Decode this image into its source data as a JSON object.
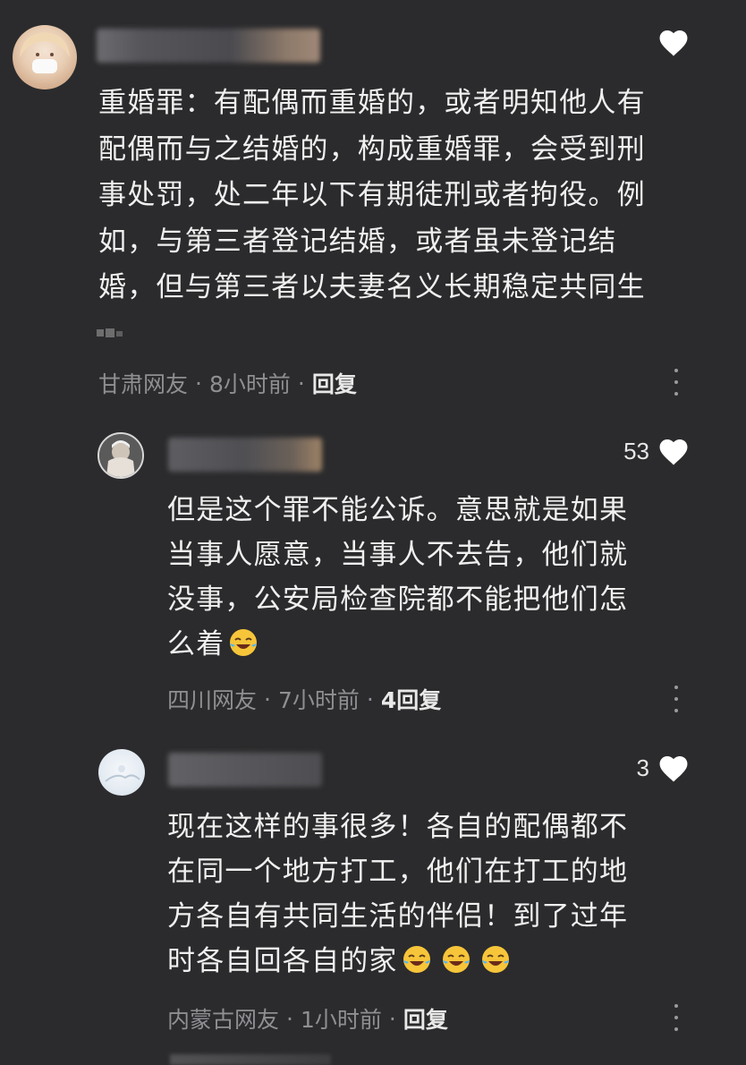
{
  "comments": [
    {
      "username": "",
      "text_lines": [
        "重婚罪：有配偶而重婚的，或者明知他人有",
        "配偶而与之结婚的，构成重婚罪，会受到刑",
        "事处罚，处二年以下有期徒刑或者拘役。例",
        "如，与第三者登记结婚，或者虽未登记结",
        "婚，但与第三者以夫妻名义长期稳定共同生"
      ],
      "location": "甘肃网友",
      "time": "8小时前",
      "reply": "回复",
      "like_count": "",
      "icon": "heart-icon"
    },
    {
      "username": "",
      "text_lines": [
        "但是这个罪不能公诉。意思就是如果",
        "当事人愿意，当事人不去告，他们就",
        "没事，公安局检查院都不能把他们怎",
        "么着"
      ],
      "location": "四川网友",
      "time": "7小时前",
      "reply": "4回复",
      "like_count": "53",
      "icon": "heart-icon"
    },
    {
      "username": "",
      "text_lines": [
        "现在这样的事很多！各自的配偶都不",
        "在同一个地方打工，他们在打工的地",
        "方各自有共同生活的伴侣！到了过年",
        "时各自回各自的家"
      ],
      "location": "内蒙古网友",
      "time": "1小时前",
      "reply": "回复",
      "like_count": "3",
      "icon": "heart-icon"
    }
  ],
  "separator": "·",
  "colors": {
    "background": "#2b2b2d",
    "text": "#f0f0f0",
    "meta": "#8f8f93",
    "heart": "#ffffff"
  }
}
